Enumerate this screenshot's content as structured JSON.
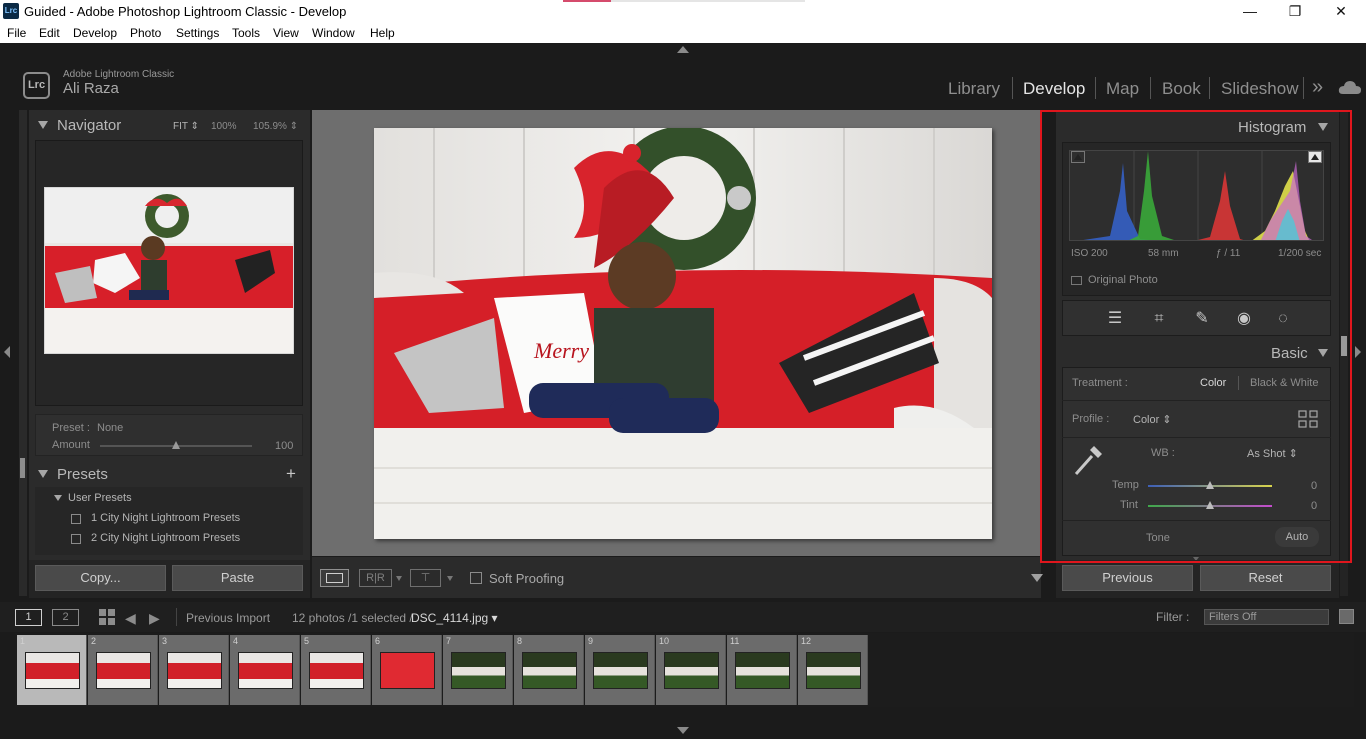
{
  "window": {
    "app_icon": "Lrc",
    "title": "Guided - Adobe Photoshop Lightroom Classic - Develop",
    "minimize": "—",
    "restore": "❐",
    "close": "✕"
  },
  "menu": [
    "File",
    "Edit",
    "Develop",
    "Photo",
    "Settings",
    "Tools",
    "View",
    "Window",
    "Help"
  ],
  "identity": {
    "logo": "Lrc",
    "product": "Adobe Lightroom Classic",
    "user": "Ali Raza"
  },
  "modules": {
    "library": "Library",
    "develop": "Develop",
    "map": "Map",
    "book": "Book",
    "slideshow": "Slideshow",
    "more": "»"
  },
  "navigator": {
    "title": "Navigator",
    "fit": "FIT ⇕",
    "zoom100": "100%",
    "zoom_custom": "105.9% ⇕",
    "preset_label": "Preset :",
    "preset_value": "None",
    "amount_label": "Amount",
    "amount_value": "100",
    "amount_fraction": 0.5
  },
  "presets": {
    "title": "Presets",
    "add": "+",
    "group": "User Presets",
    "items": [
      "1 City Night Lightroom Presets",
      "2 City Night Lightroom Presets"
    ]
  },
  "left_buttons": {
    "copy": "Copy...",
    "paste": "Paste"
  },
  "toolbar": {
    "soft_proofing": "Soft Proofing"
  },
  "histogram": {
    "title": "Histogram",
    "iso": "ISO 200",
    "focal": "58 mm",
    "aperture": "ƒ / 11",
    "shutter": "1/200 sec",
    "original_photo": "Original Photo"
  },
  "basic": {
    "title": "Basic",
    "treatment_label": "Treatment :",
    "treatment_color": "Color",
    "treatment_bw": "Black & White",
    "profile_label": "Profile :",
    "profile_value": "Color ⇕",
    "wb_label": "WB :",
    "wb_value": "As Shot ⇕",
    "temp_label": "Temp",
    "temp_value": "0",
    "tint_label": "Tint",
    "tint_value": "0",
    "temp_fraction": 0.5,
    "tint_fraction": 0.5,
    "tone_label": "Tone",
    "auto": "Auto"
  },
  "right_buttons": {
    "previous": "Previous",
    "reset": "Reset"
  },
  "filmstrip": {
    "page1": "1",
    "page2": "2",
    "source": "Previous Import",
    "count": "12 photos /1 selected /",
    "filename": "DSC_4114.jpg ▾",
    "filter_label": "Filter :",
    "filter_value": "Filters Off",
    "thumb_numbers": [
      "1",
      "2",
      "3",
      "4",
      "5",
      "6",
      "7",
      "8",
      "9",
      "10",
      "11",
      "12"
    ],
    "thumb_kinds": [
      "red",
      "red",
      "red",
      "red",
      "red",
      "redflat",
      "green",
      "green",
      "green",
      "green",
      "green",
      "green"
    ]
  },
  "colors": {
    "highlight_box": "#e0161d",
    "panel": "#2b2b2b",
    "background": "#1b1b1b",
    "center_bg": "#6e6e6e"
  }
}
